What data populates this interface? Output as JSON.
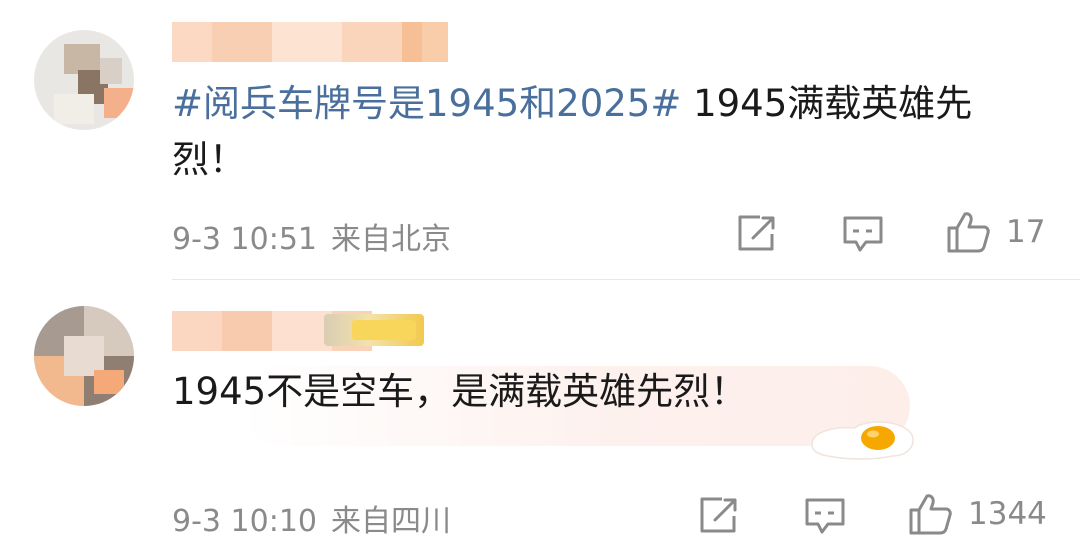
{
  "comments": [
    {
      "topic": "#阅兵车牌号是1945和2025#",
      "text": " 1945满载英雄先烈！",
      "time": "9-3 10:51",
      "location": "来自北京",
      "like_count": "17",
      "icons": [
        "share-icon",
        "comment-icon",
        "like-icon"
      ]
    },
    {
      "text": "1945不是空车，是满载英雄先烈！",
      "time": "9-3 10:10",
      "location": "来自四川",
      "like_count": "1344",
      "icons": [
        "share-icon",
        "comment-icon",
        "like-icon",
        "fried-egg-sticker"
      ]
    }
  ],
  "colors": {
    "topic_link": "#4a6f9c",
    "meta_text": "#8a8a8a",
    "body_text": "#1a1a1a",
    "nickname_blur": "#f7c9a8"
  }
}
